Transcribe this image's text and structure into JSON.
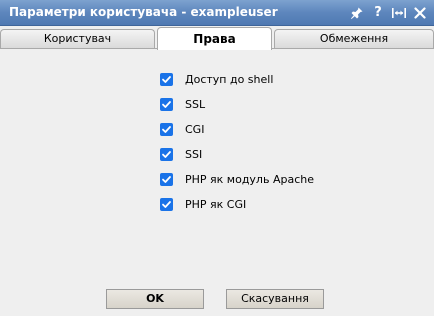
{
  "window": {
    "title": "Параметри користувача - exampleuser",
    "tools": [
      "pin-icon",
      "help-icon",
      "maximize-icon",
      "close-icon"
    ],
    "tool_labels": [
      "?"
    ]
  },
  "tabs": [
    {
      "label": "Користувач",
      "active": false
    },
    {
      "label": "Права",
      "active": true
    },
    {
      "label": "Обмеження",
      "active": false
    }
  ],
  "permissions": [
    {
      "label": "Доступ до shell",
      "checked": true
    },
    {
      "label": "SSL",
      "checked": true
    },
    {
      "label": "CGI",
      "checked": true
    },
    {
      "label": "SSI",
      "checked": true
    },
    {
      "label": "PHP як модуль Apache",
      "checked": true
    },
    {
      "label": "PHP як CGI",
      "checked": true
    }
  ],
  "buttons": {
    "ok_label": "OK",
    "cancel_label": "Скасування"
  },
  "colors": {
    "titlebar": "#5d86bd",
    "checkbox": "#1a73e8",
    "background": "#efefef"
  }
}
